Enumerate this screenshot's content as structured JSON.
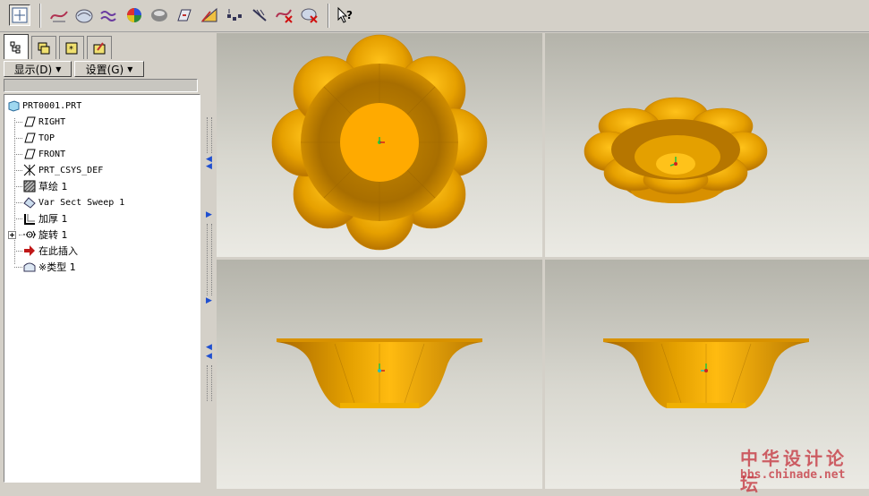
{
  "toolbar": {
    "buttons": [
      "orient-icon",
      "datum-curve-icon",
      "sketch-surface-icon",
      "wave-curve-icon",
      "shade-icon",
      "render-icon",
      "datum-plane-icon",
      "axis-icon",
      "points-icon",
      "coord-icon",
      "delete-icon",
      "remove-icon",
      "whats-this-icon"
    ]
  },
  "left_panel": {
    "show_label": "显示(D)",
    "settings_label": "设置(G)",
    "tree": {
      "root": "PRT0001.PRT",
      "items": [
        {
          "label": "RIGHT",
          "icon": "datum-plane-icon"
        },
        {
          "label": "TOP",
          "icon": "datum-plane-icon"
        },
        {
          "label": "FRONT",
          "icon": "datum-plane-icon"
        },
        {
          "label": "PRT_CSYS_DEF",
          "icon": "csys-icon"
        },
        {
          "label": "草绘 1",
          "icon": "sketch-icon"
        },
        {
          "label": "Var Sect Sweep 1",
          "icon": "sweep-icon"
        },
        {
          "label": "加厚 1",
          "icon": "thicken-icon"
        },
        {
          "label": "旋转 1",
          "icon": "revolve-icon"
        },
        {
          "label": "在此插入",
          "icon": "insert-here-icon"
        },
        {
          "label": "※类型 1",
          "icon": "type-icon"
        }
      ]
    }
  },
  "watermark": {
    "cn": "中华设计论坛",
    "en": "bbs.chinade.net"
  },
  "colors": {
    "model": "#e6a000",
    "model_dark": "#b87400",
    "model_light": "#ffc21a",
    "bg_top": "#b4b3aa",
    "bg_bottom": "#ebeae4"
  }
}
